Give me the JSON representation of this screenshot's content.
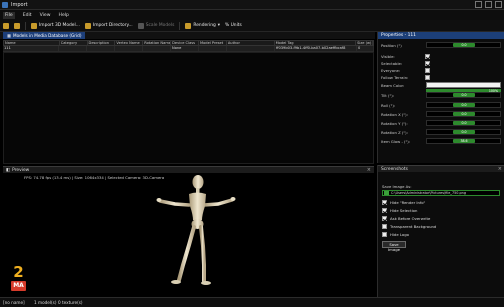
{
  "window": {
    "title": "Import"
  },
  "menu": {
    "items": [
      "File",
      "Edit",
      "View",
      "Help"
    ]
  },
  "toolbar": {
    "open_label": "",
    "import_model": "Import 3D Model...",
    "import_directory": "Import Directory...",
    "scale_models": "Scale Models",
    "rendering": "Rendering",
    "units": "% Units"
  },
  "tab": {
    "label": "Models in Media Database (Grid)"
  },
  "grid": {
    "columns": [
      "Name",
      "Category",
      "Description",
      "Vertex Name",
      "Rotation Name",
      "Device Class",
      "Model Preset",
      "Author",
      "Model Tag",
      "Size (w)"
    ],
    "row": [
      "111",
      "",
      "",
      "",
      "",
      "None",
      "",
      "",
      "ff039b03-f9b1-4ff0-ba07-b02aeffbcaf8",
      "0"
    ]
  },
  "preview": {
    "title": "Preview",
    "fps": "FPS: 74.78 fps (13.4 ms) | Size: 1064x334 | Selected Camera: 3D-Camera"
  },
  "properties": {
    "title": "Properties - 111",
    "rows": [
      {
        "label": "Position (\")",
        "kind": "value",
        "value": "0.0"
      },
      {
        "label": "Visible:",
        "kind": "check",
        "checked": true
      },
      {
        "label": "Selectable:",
        "kind": "check",
        "checked": true
      },
      {
        "label": "Everyone:",
        "kind": "check",
        "checked": false
      },
      {
        "label": "Follow Terrain:",
        "kind": "check",
        "checked": false
      },
      {
        "label": "Beam Color:",
        "kind": "color",
        "value": "100%"
      },
      {
        "label": "Tilt (\"):",
        "kind": "value",
        "value": "0.0"
      },
      {
        "label": "Roll (\"):",
        "kind": "value",
        "value": "0.0"
      },
      {
        "label": "Rotation X (\"):",
        "kind": "value",
        "value": "0.0"
      },
      {
        "label": "Rotation Y (\"):",
        "kind": "value",
        "value": "0.0"
      },
      {
        "label": "Rotation Z (\"):",
        "kind": "value",
        "value": "0.0"
      },
      {
        "label": "Item Glow - (\"):",
        "kind": "value",
        "value": "38.6"
      }
    ]
  },
  "screenshots": {
    "title": "Screenshots",
    "save_label": "Save Image As:",
    "path": "C:\\Users\\Administrator\\Pictures\\file_750.png",
    "options": [
      {
        "label": "Hide \"Render Info\"",
        "checked": true
      },
      {
        "label": "Hide Selection",
        "checked": true
      },
      {
        "label": "Ask Before Overwrite",
        "checked": true
      },
      {
        "label": "Transparent Background",
        "checked": false
      },
      {
        "label": "Hide Logo",
        "checked": false
      }
    ],
    "save_button": "Save Image"
  },
  "status": {
    "names": "[no name]",
    "models": "1 model(s)",
    "textures": "0 texture(s)"
  },
  "badge": {
    "digit": "2",
    "letters": "MA"
  }
}
